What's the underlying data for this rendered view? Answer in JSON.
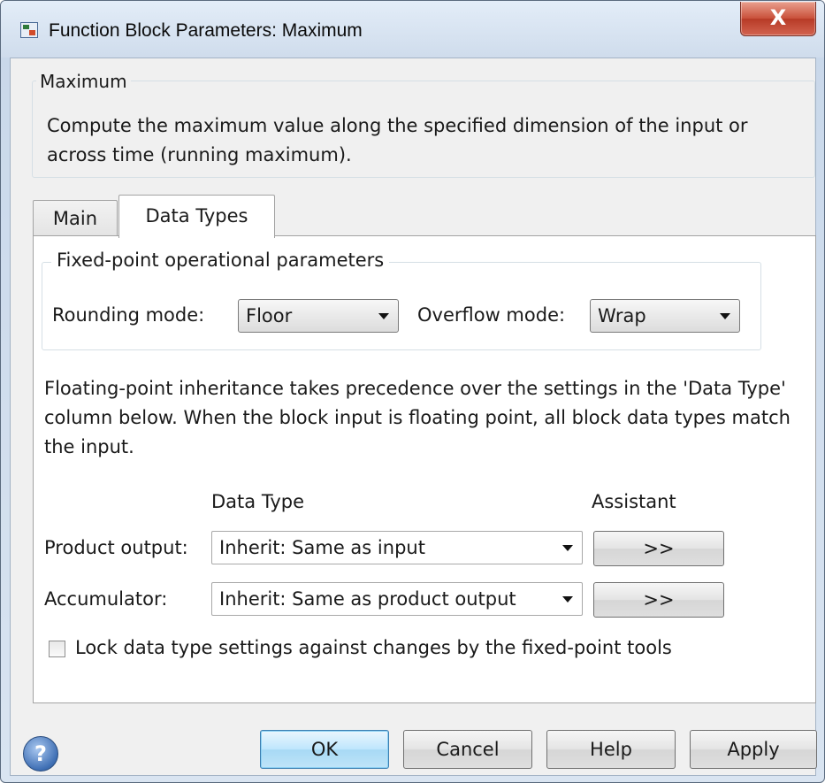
{
  "window": {
    "title": "Function Block Parameters: Maximum",
    "close_label": "X"
  },
  "description": {
    "group_title": "Maximum",
    "text": "Compute the maximum value along the specified dimension of the input or across time (running maximum)."
  },
  "tabs": [
    {
      "label": "Main",
      "selected": false
    },
    {
      "label": "Data Types",
      "selected": true
    }
  ],
  "fixed_point": {
    "group_title": "Fixed-point operational parameters",
    "rounding_label": "Rounding mode:",
    "rounding_value": "Floor",
    "overflow_label": "Overflow mode:",
    "overflow_value": "Wrap"
  },
  "inheritance_note": "Floating-point inheritance takes precedence over the settings in the 'Data Type' column below. When the block input is floating point, all block data types match the input.",
  "table": {
    "col_data_type": "Data Type",
    "col_assistant": "Assistant",
    "rows": [
      {
        "label": "Product output:",
        "value": "Inherit: Same as input",
        "assistant": ">>"
      },
      {
        "label": "Accumulator:",
        "value": "Inherit: Same as product output",
        "assistant": ">>"
      }
    ]
  },
  "lock": {
    "label": "Lock data type settings against changes by the fixed-point tools",
    "checked": false
  },
  "footer": {
    "help_icon_glyph": "?",
    "ok": "OK",
    "cancel": "Cancel",
    "help": "Help",
    "apply": "Apply"
  },
  "colors": {
    "close_button": "#c9503a",
    "window_frame": "#c9d8ea",
    "ok_focus": "#3c7fb1"
  }
}
